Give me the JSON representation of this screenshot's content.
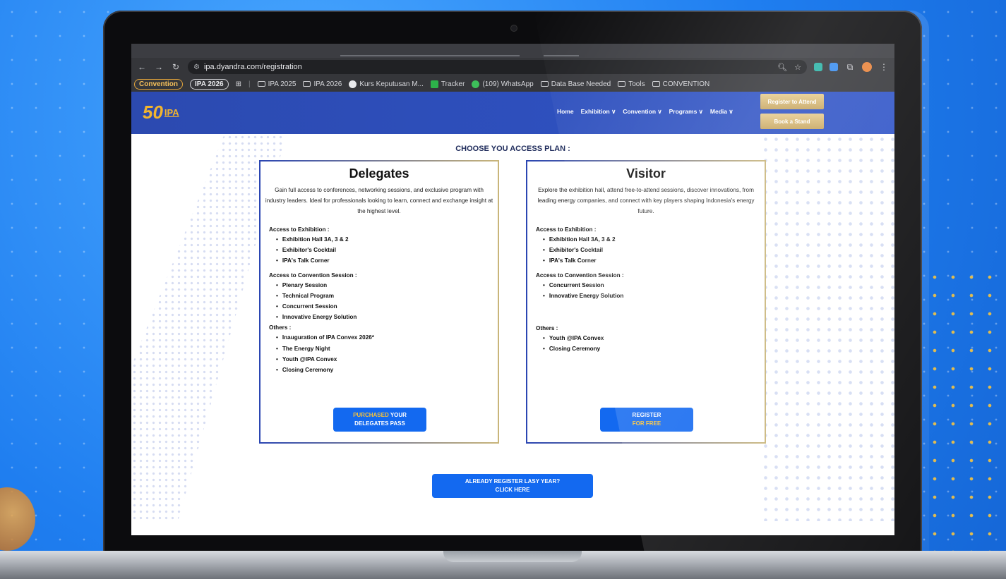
{
  "browser": {
    "url": "ipa.dyandra.com/registration",
    "bookmarks": {
      "chip_convention": "Convention",
      "chip_ipa2026": "IPA 2026",
      "items": [
        "IPA 2025",
        "IPA 2026",
        "Kurs Keputusan M...",
        "Tracker",
        "(109) WhatsApp",
        "Data Base Needed",
        "Tools",
        "CONVENTION"
      ]
    }
  },
  "site": {
    "logo_number": "50",
    "logo_text": "IPA",
    "nav": {
      "home": "Home",
      "exhibition": "Exhibition ∨",
      "convention": "Convention ∨",
      "programs": "Programs ∨",
      "media": "Media ∨"
    },
    "register_btn": "Register to Attend",
    "stand_btn": "Book a Stand"
  },
  "page": {
    "heading": "CHOOSE YOU ACCESS PLAN :",
    "delegates": {
      "title": "Delegates",
      "description": "Gain full access to conferences, networking sessions, and exclusive program with industry leaders. Ideal for professionals looking to learn, connect and exchange insight at the highest level.",
      "exhibition_title": "Access to Exhibition :",
      "exhibition": [
        "Exhibition Hall 3A, 3 & 2",
        "Exhibitor's Cocktail",
        "IPA's Talk Corner"
      ],
      "convention_title": "Access to Convention Session :",
      "convention": [
        "Plenary Session",
        "Technical Program",
        "Concurrent Session",
        "Innovative Energy Solution"
      ],
      "others_title": "Others :",
      "others": [
        "Inauguration of IPA Convex 2026*",
        "The Energy Night",
        "Youth @IPA Convex",
        "Closing Ceremony"
      ],
      "btn_gold": "PURCHASED",
      "btn_rest": " YOUR",
      "btn_line2": "DELEGATES PASS"
    },
    "visitor": {
      "title": "Visitor",
      "description": "Explore the exhibition hall, attend free-to-attend sessions, discover innovations, from leading energy companies, and connect with key players shaping Indonesia's energy future.",
      "exhibition_title": "Access to Exhibition :",
      "exhibition": [
        "Exhibition Hall 3A, 3 & 2",
        "Exhibitor's Cocktail",
        "IPA's Talk Corner"
      ],
      "convention_title": "Access to Convention Session :",
      "convention": [
        "Concurrent Session",
        "Innovative Energy Solution"
      ],
      "others_title": "Others :",
      "others": [
        "Youth @IPA Convex",
        "Closing Ceremony"
      ],
      "btn_line1": "REGISTER",
      "btn_line2": "FOR FREE"
    },
    "already_line1": "ALREADY REGISTER LASY YEAR?",
    "already_line2": "CLICK HERE"
  }
}
